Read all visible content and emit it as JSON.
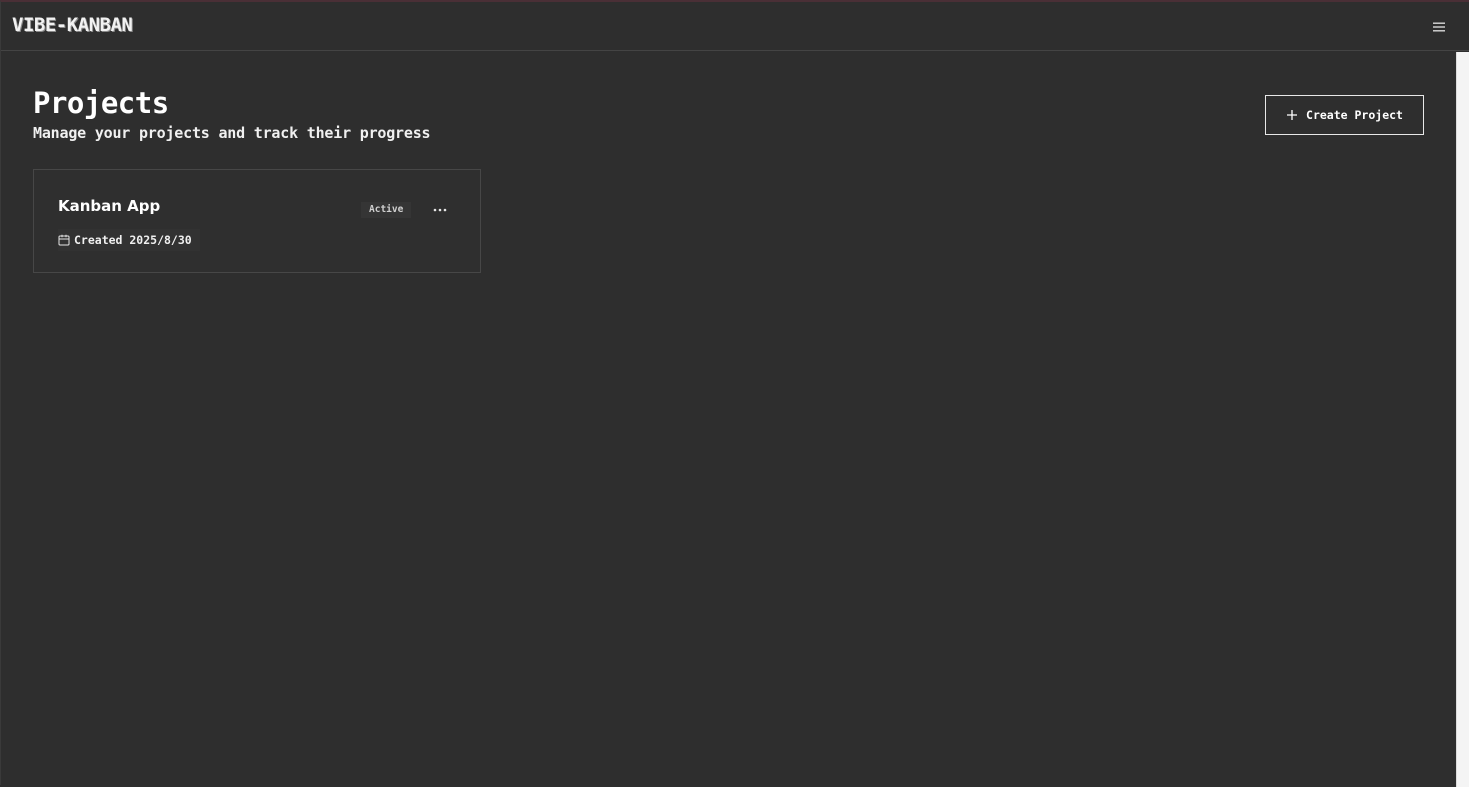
{
  "app": {
    "logo_text": "VIBE-KANBAN"
  },
  "header": {
    "menu_icon": "hamburger-menu-icon"
  },
  "page": {
    "title": "Projects",
    "subtitle": "Manage your projects and track their progress",
    "create_button_label": "Create Project",
    "create_button_icon": "plus-icon"
  },
  "projects": [
    {
      "name": "Kanban App",
      "status": "Active",
      "created_label": "Created 2025/8/30",
      "created_icon": "calendar-icon",
      "actions_icon": "more-horizontal-icon"
    }
  ],
  "colors": {
    "background": "#2e2e2e",
    "text": "#ffffff",
    "border": "#474747"
  }
}
